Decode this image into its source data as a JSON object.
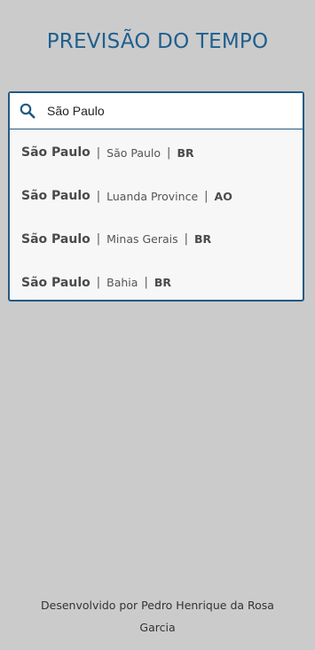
{
  "header": {
    "title": "PREVISÃO DO TEMPO"
  },
  "search": {
    "icon": "search-icon",
    "value": "São Paulo"
  },
  "results": [
    {
      "city": "São Paulo",
      "separator": "|",
      "region": "São Paulo",
      "country": "BR"
    },
    {
      "city": "São Paulo",
      "separator": "|",
      "region": "Luanda Province",
      "country": "AO"
    },
    {
      "city": "São Paulo",
      "separator": "|",
      "region": "Minas Gerais",
      "country": "BR"
    },
    {
      "city": "São Paulo",
      "separator": "|",
      "region": "Bahia",
      "country": "BR"
    }
  ],
  "footer": {
    "credit": "Desenvolvido por Pedro Henrique da Rosa Garcia"
  },
  "colors": {
    "accent": "#235a82",
    "title": "#1f5f8e",
    "background": "#cbcbcb"
  }
}
